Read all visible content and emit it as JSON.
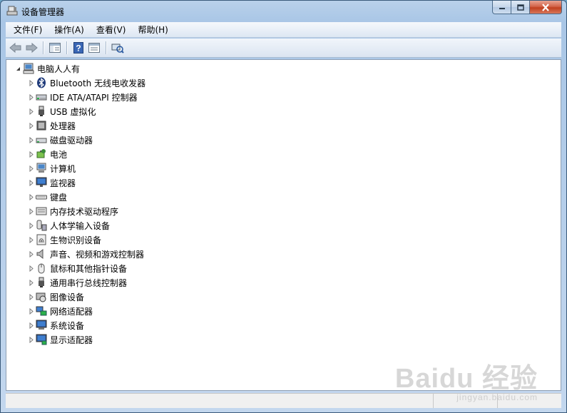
{
  "window": {
    "title": "设备管理器"
  },
  "menu": [
    "文件(F)",
    "操作(A)",
    "查看(V)",
    "帮助(H)"
  ],
  "toolbar": [
    "back-icon",
    "forward-icon",
    "show-hide-tree-icon",
    "help-icon",
    "properties-icon",
    "scan-hardware-icon"
  ],
  "tree": {
    "root": {
      "label": "电脑人人有",
      "icon": "computer-icon",
      "expanded": true
    },
    "children": [
      {
        "label": "Bluetooth 无线电收发器",
        "icon": "bluetooth-icon"
      },
      {
        "label": "IDE ATA/ATAPI 控制器",
        "icon": "ide-controller-icon"
      },
      {
        "label": "USB 虚拟化",
        "icon": "usb-icon"
      },
      {
        "label": "处理器",
        "icon": "processor-icon"
      },
      {
        "label": "磁盘驱动器",
        "icon": "disk-drive-icon"
      },
      {
        "label": "电池",
        "icon": "battery-icon"
      },
      {
        "label": "计算机",
        "icon": "computer-icon"
      },
      {
        "label": "监视器",
        "icon": "monitor-icon"
      },
      {
        "label": "键盘",
        "icon": "keyboard-icon"
      },
      {
        "label": "内存技术驱动程序",
        "icon": "memory-icon"
      },
      {
        "label": "人体学输入设备",
        "icon": "hid-icon"
      },
      {
        "label": "生物识别设备",
        "icon": "fingerprint-icon"
      },
      {
        "label": "声音、视频和游戏控制器",
        "icon": "speaker-icon"
      },
      {
        "label": "鼠标和其他指针设备",
        "icon": "mouse-icon"
      },
      {
        "label": "通用串行总线控制器",
        "icon": "usb-controller-icon"
      },
      {
        "label": "图像设备",
        "icon": "camera-icon"
      },
      {
        "label": "网络适配器",
        "icon": "network-icon"
      },
      {
        "label": "系统设备",
        "icon": "system-device-icon"
      },
      {
        "label": "显示适配器",
        "icon": "display-adapter-icon"
      }
    ]
  },
  "watermark": {
    "brand": "Baidu 经验",
    "url": "jingyan.baidu.com"
  }
}
